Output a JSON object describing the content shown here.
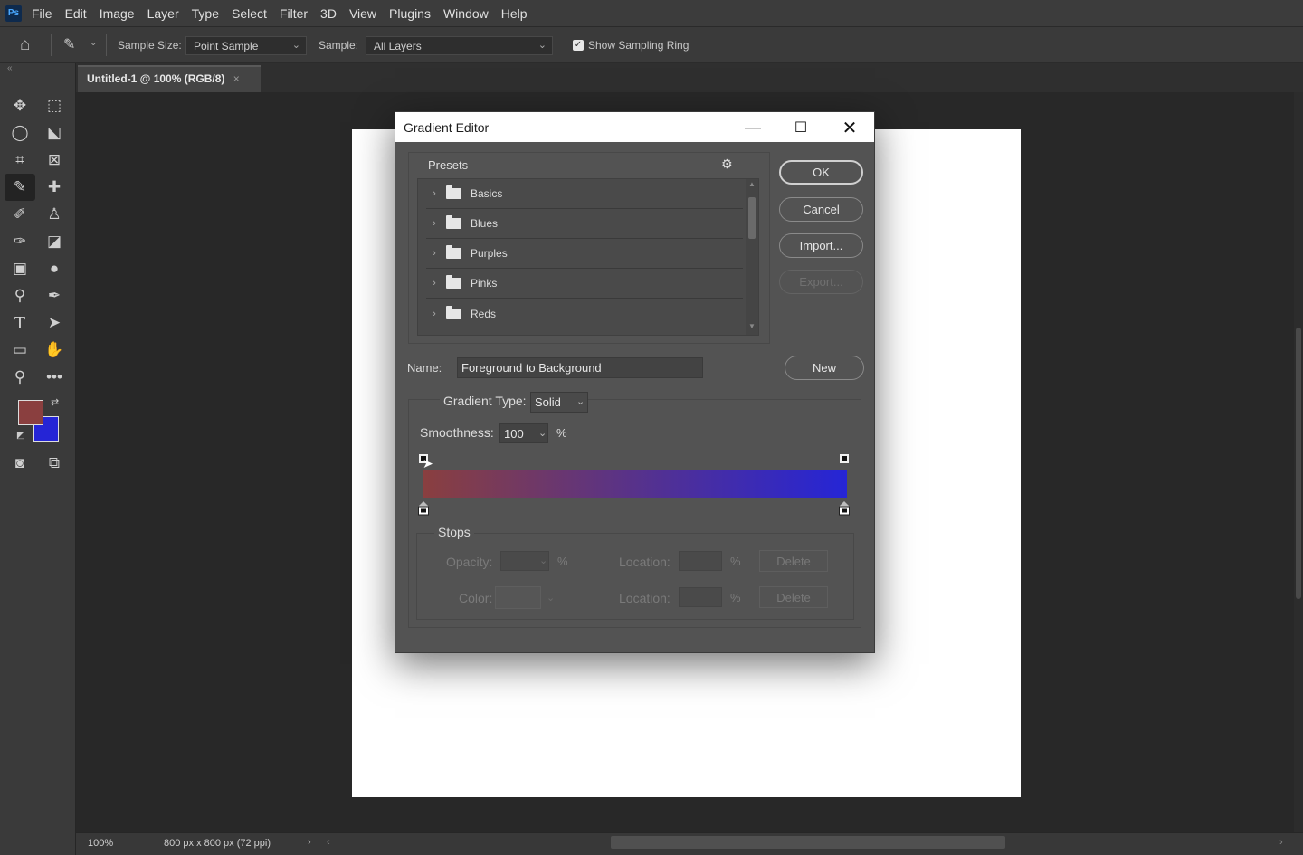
{
  "app": {
    "logo": "Ps"
  },
  "menu": [
    "File",
    "Edit",
    "Image",
    "Layer",
    "Type",
    "Select",
    "Filter",
    "3D",
    "View",
    "Plugins",
    "Window",
    "Help"
  ],
  "options": {
    "sample_size_label": "Sample Size:",
    "sample_size_value": "Point Sample",
    "sample_label": "Sample:",
    "sample_value": "All Layers",
    "show_ring_label": "Show Sampling Ring",
    "show_ring_checked": true
  },
  "document_tab": {
    "title": "Untitled-1 @ 100% (RGB/8)",
    "close": "×"
  },
  "colors": {
    "foreground": "#8a3f3f",
    "background": "#2525d6"
  },
  "status": {
    "zoom": "100%",
    "doc_info": "800 px x 800 px (72 ppi)"
  },
  "dialog": {
    "title": "Gradient Editor",
    "presets": {
      "title": "Presets",
      "items": [
        "Basics",
        "Blues",
        "Purples",
        "Pinks",
        "Reds"
      ]
    },
    "buttons": {
      "ok": "OK",
      "cancel": "Cancel",
      "import": "Import...",
      "export": "Export...",
      "new": "New"
    },
    "name": {
      "label": "Name:",
      "value": "Foreground to Background"
    },
    "gradient_type": {
      "label": "Gradient Type:",
      "value": "Solid"
    },
    "smoothness": {
      "label": "Smoothness:",
      "value": "100",
      "unit": "%"
    },
    "gradient": {
      "start_color": "#8a3f3f",
      "end_color": "#2525d6"
    },
    "stops": {
      "title": "Stops",
      "opacity_label": "Opacity:",
      "opacity_unit": "%",
      "location_label": "Location:",
      "location_unit": "%",
      "color_label": "Color:",
      "delete_label": "Delete"
    }
  }
}
